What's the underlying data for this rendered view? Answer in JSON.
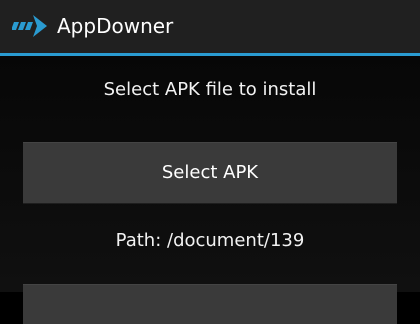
{
  "action_bar": {
    "title": "AppDowner",
    "icon": "appdowner-arrow-icon",
    "accent_color": "#2a9bd1"
  },
  "main": {
    "instruction": "Select APK file to install",
    "select_button_label": "Select APK",
    "path_text": "Path: /document/139"
  }
}
